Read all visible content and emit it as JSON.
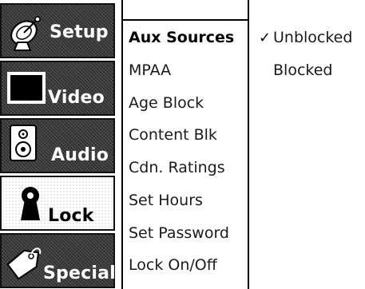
{
  "nav": [
    {
      "label": "Setup",
      "icon": "satellite-dish-icon"
    },
    {
      "label": "Video",
      "icon": "tv-screen-icon"
    },
    {
      "label": "Audio",
      "icon": "speaker-icon"
    },
    {
      "label": "Lock",
      "icon": "keyhole-icon",
      "selected": true
    },
    {
      "label": "Special",
      "icon": "tag-icon"
    }
  ],
  "menu": {
    "items": [
      "Aux Sources",
      "MPAA",
      "Age Block",
      "Content Blk",
      "Cdn. Ratings",
      "Set Hours",
      "Set Password",
      "Lock On/Off"
    ],
    "active_index": 0
  },
  "options": {
    "check_glyph": "✓",
    "items": [
      "Unblocked",
      "Blocked"
    ],
    "selected_index": 0
  },
  "colors": {
    "nav_background": "#3a3a3a",
    "nav_selected_background": "#ffffff",
    "text": "#000000"
  }
}
